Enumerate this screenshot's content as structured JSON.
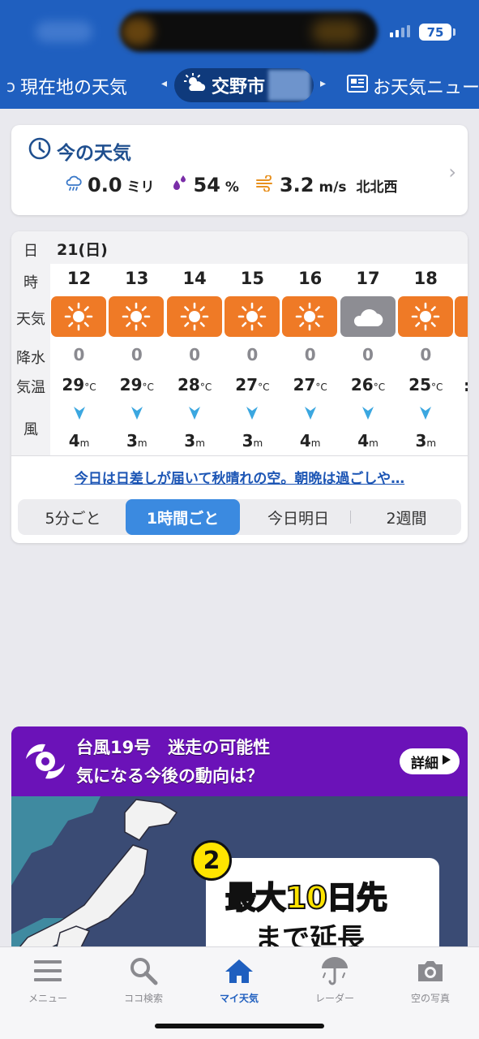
{
  "status_bar": {
    "battery": "75"
  },
  "top_nav": {
    "left_label": "現在地の天気",
    "center_label": "交野市",
    "right_label": "お天気ニュー"
  },
  "now_card": {
    "title": "今の天気",
    "precip_value": "0.0",
    "precip_unit": "ミリ",
    "humidity_value": "54",
    "humidity_unit": "%",
    "wind_value": "3.2",
    "wind_unit": "m/s",
    "wind_dir": "北北西"
  },
  "forecast": {
    "row_labels": {
      "day": "日",
      "hour": "時",
      "weather": "天気",
      "rain": "降水",
      "temp": "気温",
      "wind": "風"
    },
    "date": "21(日)",
    "temp_unit": "°C",
    "wind_unit": "m",
    "hours": [
      {
        "hour": "12",
        "icon": "sun-icon",
        "rain": "0",
        "temp": "29",
        "wind": "4"
      },
      {
        "hour": "13",
        "icon": "sun-icon",
        "rain": "0",
        "temp": "29",
        "wind": "3"
      },
      {
        "hour": "14",
        "icon": "sun-icon",
        "rain": "0",
        "temp": "28",
        "wind": "3"
      },
      {
        "hour": "15",
        "icon": "sun-icon",
        "rain": "0",
        "temp": "27",
        "wind": "3"
      },
      {
        "hour": "16",
        "icon": "sun-icon",
        "rain": "0",
        "temp": "27",
        "wind": "4"
      },
      {
        "hour": "17",
        "icon": "cloud-icon",
        "rain": "0",
        "temp": "26",
        "wind": "4"
      },
      {
        "hour": "18",
        "icon": "sun-icon",
        "rain": "0",
        "temp": "25",
        "wind": "3"
      }
    ],
    "comment": "今日は日差しが届いて秋晴れの空。朝晩は過ごしや…",
    "segments": [
      "5分ごと",
      "1時間ごと",
      "今日明日",
      "2週間"
    ],
    "active_segment": "1時間ごと"
  },
  "banner": {
    "line1": "台風19号　迷走の可能性",
    "line2": "気になる今後の動向は？",
    "detail_button": "詳細",
    "badge": "2",
    "promo_line1": "最大10日先",
    "promo_line2": "まで延長"
  },
  "tabbar": {
    "items": [
      {
        "label": "メニュー",
        "icon": "menu-icon"
      },
      {
        "label": "ココ検索",
        "icon": "search-icon"
      },
      {
        "label": "マイ天気",
        "icon": "home-icon"
      },
      {
        "label": "レーダー",
        "icon": "umbrella-icon"
      },
      {
        "label": "空の写真",
        "icon": "camera-icon"
      }
    ],
    "active": "マイ天気"
  },
  "colors": {
    "brand_blue": "#1f5fbf",
    "sunny_orange": "#ef7a26",
    "cloudy_gray": "#8d8d93",
    "active_tab": "#3b8ae0",
    "banner_purple": "#6b12b8"
  }
}
